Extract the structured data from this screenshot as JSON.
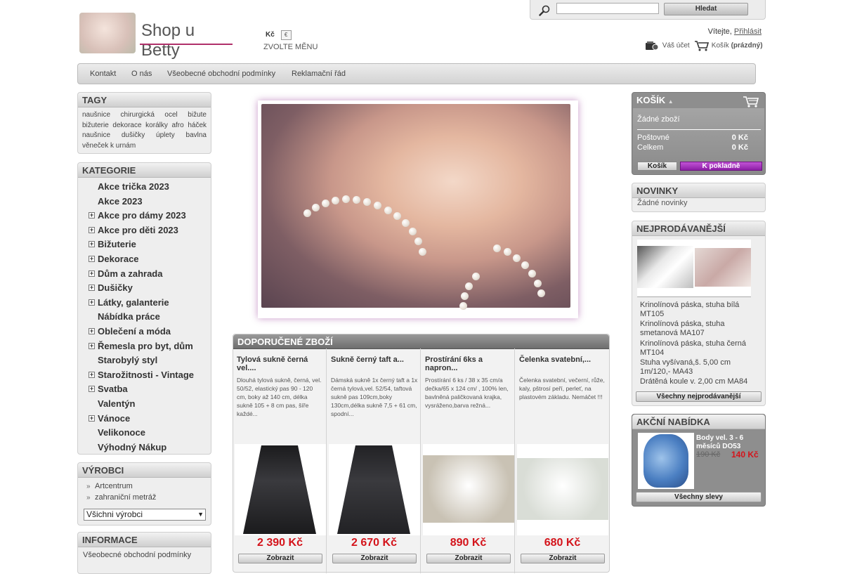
{
  "header": {
    "logo_text": "Shop u Betty",
    "currency_current": "Kč",
    "currency_alt": "€",
    "choose_menu": "ZVOLTE MĚNU",
    "search_button": "Hledat",
    "welcome": "Vítejte,",
    "login": "Přihlásit",
    "account": "Váš účet",
    "cart_label": "Košík",
    "cart_status": "(prázdný)"
  },
  "nav": [
    "Kontakt",
    "O nás",
    "Všeobecné obchodní podmínky",
    "Reklamační řád"
  ],
  "tags": {
    "title": "TAGY",
    "cloud": "naušnice chirurgická ocel bižute bižuterie dekorace korálky afro háček naušnice dušičky úplety bavlna věneček k urnám"
  },
  "categories": {
    "title": "KATEGORIE",
    "items": [
      {
        "label": "Akce trička 2023",
        "expand": false
      },
      {
        "label": "Akce 2023",
        "expand": false
      },
      {
        "label": "Akce pro dámy 2023",
        "expand": true
      },
      {
        "label": "Akce pro děti 2023",
        "expand": true
      },
      {
        "label": "Bižuterie",
        "expand": true
      },
      {
        "label": "Dekorace",
        "expand": true
      },
      {
        "label": "Dům a zahrada",
        "expand": true
      },
      {
        "label": "Dušičky",
        "expand": true
      },
      {
        "label": "Látky, galanterie",
        "expand": true
      },
      {
        "label": "Nábídka práce",
        "expand": false
      },
      {
        "label": "Oblečení a móda",
        "expand": true
      },
      {
        "label": "Řemesla pro byt, dům",
        "expand": true
      },
      {
        "label": "Starobylý styl",
        "expand": false
      },
      {
        "label": "Starožitnosti - Vintage",
        "expand": true
      },
      {
        "label": "Svatba",
        "expand": true
      },
      {
        "label": "Valentýn",
        "expand": false
      },
      {
        "label": "Vánoce",
        "expand": true
      },
      {
        "label": "Velikonoce",
        "expand": false
      },
      {
        "label": "Výhodný Nákup",
        "expand": false
      }
    ]
  },
  "manufacturers": {
    "title": "VÝROBCI",
    "items": [
      "Artcentrum",
      "zahraniční metráž"
    ],
    "select": "Všichni výrobci"
  },
  "info": {
    "title": "INFORMACE",
    "first": "Všeobecné obchodní podmínky"
  },
  "featured": {
    "title": "DOPORUČENÉ ZBOŽÍ",
    "show_label": "Zobrazit",
    "products": [
      {
        "name": "Tylová sukně černá vel....",
        "desc": "Dlouhá tylová sukně, černá, vel. 50/52, elastický pas 90 - 120 cm, boky až 140 cm, délka sukně 105 + 8 cm pas, šíře každé...",
        "price": "2 390 Kč",
        "color": "#1b1b1d"
      },
      {
        "name": "Sukně černý taft a...",
        "desc": "Dámská sukně 1x černý taft a 1x černá tylová,vel. 52/54, taftová sukně pas 109cm,boky 130cm,délka sukně 7,5 + 61 cm, spodní...",
        "price": "2 670 Kč",
        "color": "#222225"
      },
      {
        "name": "Prostírání 6ks a napron...",
        "desc": "Prostírání 6 ks / 38 x 35 cm/a dečka/65 x 124 cm/ , 100% len, bavlněná paličkovaná krajka, vysráženo,barva režná...",
        "price": "890 Kč",
        "color": "#c9c2b4"
      },
      {
        "name": "Čelenka svatební,...",
        "desc": "Čelenka svatební, večerní, růže, kaly, pštrosí peří, perleť, na plastovém základu. Nemáčet !!!",
        "price": "680 Kč",
        "color": "#d9ddd6"
      }
    ]
  },
  "cart": {
    "title": "KOŠÍK",
    "empty": "Žádné zboží",
    "shipping_label": "Poštovné",
    "shipping_value": "0 Kč",
    "total_label": "Celkem",
    "total_value": "0 Kč",
    "cart_button": "Košík",
    "checkout_button": "K pokladně"
  },
  "news": {
    "title": "NOVINKY",
    "empty": "Žádné novinky"
  },
  "bestsellers": {
    "title": "NEJPRODÁVANĚJŠÍ",
    "items": [
      "Krinolínová páska, stuha bílá MT105",
      "Krinolínová páska, stuha smetanová MA107",
      "Krinolínová páska, stuha černá MT104",
      "Stuha vyšívaná,š. 5,00 cm 1m/120,- MA43",
      "Drátěná koule v. 2,00 cm MA84"
    ],
    "all_button": "Všechny nejprodávanější"
  },
  "sale": {
    "title": "AKČNÍ NABÍDKA",
    "name": "Body vel. 3 - 6 měsíců DO53",
    "old_price": "190 Kč",
    "new_price": "140 Kč",
    "all_button": "Všechny slevy"
  }
}
